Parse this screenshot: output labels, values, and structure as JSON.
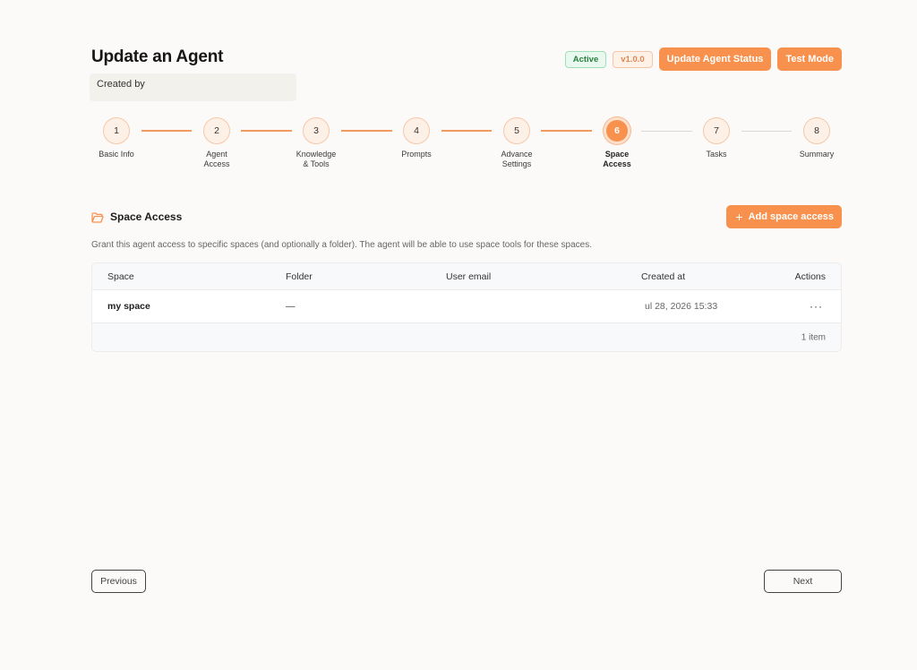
{
  "header": {
    "title": "Update an Agent",
    "created_by_label": "Created by",
    "status_badge": "Active",
    "version_badge": "v1.0.0",
    "update_status_label": "Update Agent Status",
    "test_mode_label": "Test Mode"
  },
  "stepper": {
    "current": 6,
    "steps": [
      {
        "number": "1",
        "label": "Basic Info"
      },
      {
        "number": "2",
        "label": "Agent\nAccess"
      },
      {
        "number": "3",
        "label": "Knowledge\n& Tools"
      },
      {
        "number": "4",
        "label": "Prompts"
      },
      {
        "number": "5",
        "label": "Advance\nSettings"
      },
      {
        "number": "6",
        "label": "Space\nAccess"
      },
      {
        "number": "7",
        "label": "Tasks"
      },
      {
        "number": "8",
        "label": "Summary"
      }
    ]
  },
  "section": {
    "icon": "folder-open-icon",
    "title": "Space Access",
    "add_button_icon": "plus-icon",
    "add_button_label": "Add space access",
    "description": "Grant this agent access to specific spaces (and optionally a folder). The agent will be able to use space tools for these spaces."
  },
  "table": {
    "columns": [
      "Space",
      "Folder",
      "User email",
      "Created at",
      "Actions"
    ],
    "rows": [
      {
        "space": "my space",
        "folder": "—",
        "user_email": "",
        "created_at": "ul 28, 2026 15:33",
        "actions": "···"
      }
    ],
    "footer": "1 item"
  },
  "navigation": {
    "previous_label": "Previous",
    "next_label": "Next"
  },
  "colors": {
    "accent": "#f8914d",
    "active_badge": "#25813f",
    "background": "#fcfaf8"
  }
}
